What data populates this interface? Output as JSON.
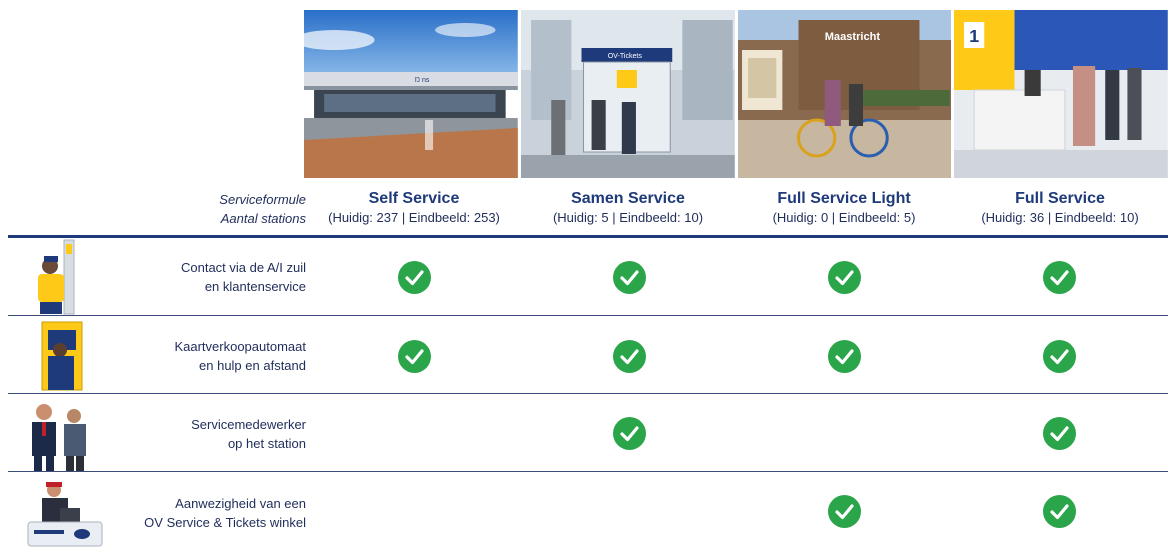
{
  "header": {
    "formula_label": "Serviceformule",
    "stations_label": "Aantal stations"
  },
  "columns": [
    {
      "title": "Self Service",
      "count": "(Huidig: 237 | Eindbeeld: 253)"
    },
    {
      "title": "Samen Service",
      "count": "(Huidig: 5 | Eindbeeld: 10)"
    },
    {
      "title": "Full Service Light",
      "count": "(Huidig: 0 | Eindbeeld: 5)"
    },
    {
      "title": "Full Service",
      "count": "(Huidig: 36 | Eindbeeld: 10)"
    }
  ],
  "features": [
    {
      "line1": "Contact via de A/I zuil",
      "line2": "en klantenservice",
      "icon": "help-pillar-person-icon",
      "checks": [
        true,
        true,
        true,
        true
      ]
    },
    {
      "line1": "Kaartverkoopautomaat",
      "line2": "en hulp en afstand",
      "icon": "ticket-machine-person-icon",
      "checks": [
        true,
        true,
        true,
        true
      ]
    },
    {
      "line1": "Servicemedewerker",
      "line2": "op het station",
      "icon": "service-staff-icon",
      "checks": [
        false,
        true,
        false,
        true
      ]
    },
    {
      "line1": "Aanwezigheid van een",
      "line2": "OV Service & Tickets winkel",
      "icon": "ticket-shop-counter-icon",
      "checks": [
        false,
        false,
        true,
        true
      ]
    }
  ],
  "photos": [
    {
      "icon": "self-service-station-photo",
      "sign": "Ŋ ns"
    },
    {
      "icon": "samen-service-kiosk-photo",
      "sign": "OV-Tickets"
    },
    {
      "icon": "full-service-light-station-photo",
      "sign": "Maastricht"
    },
    {
      "icon": "full-service-desk-photo",
      "sign": "1"
    }
  ],
  "colors": {
    "navy": "#1f3a7a",
    "text": "#1f2d5a",
    "check_green": "#2aa54a",
    "ns_yellow": "#ffc917",
    "ns_blue": "#003082"
  }
}
